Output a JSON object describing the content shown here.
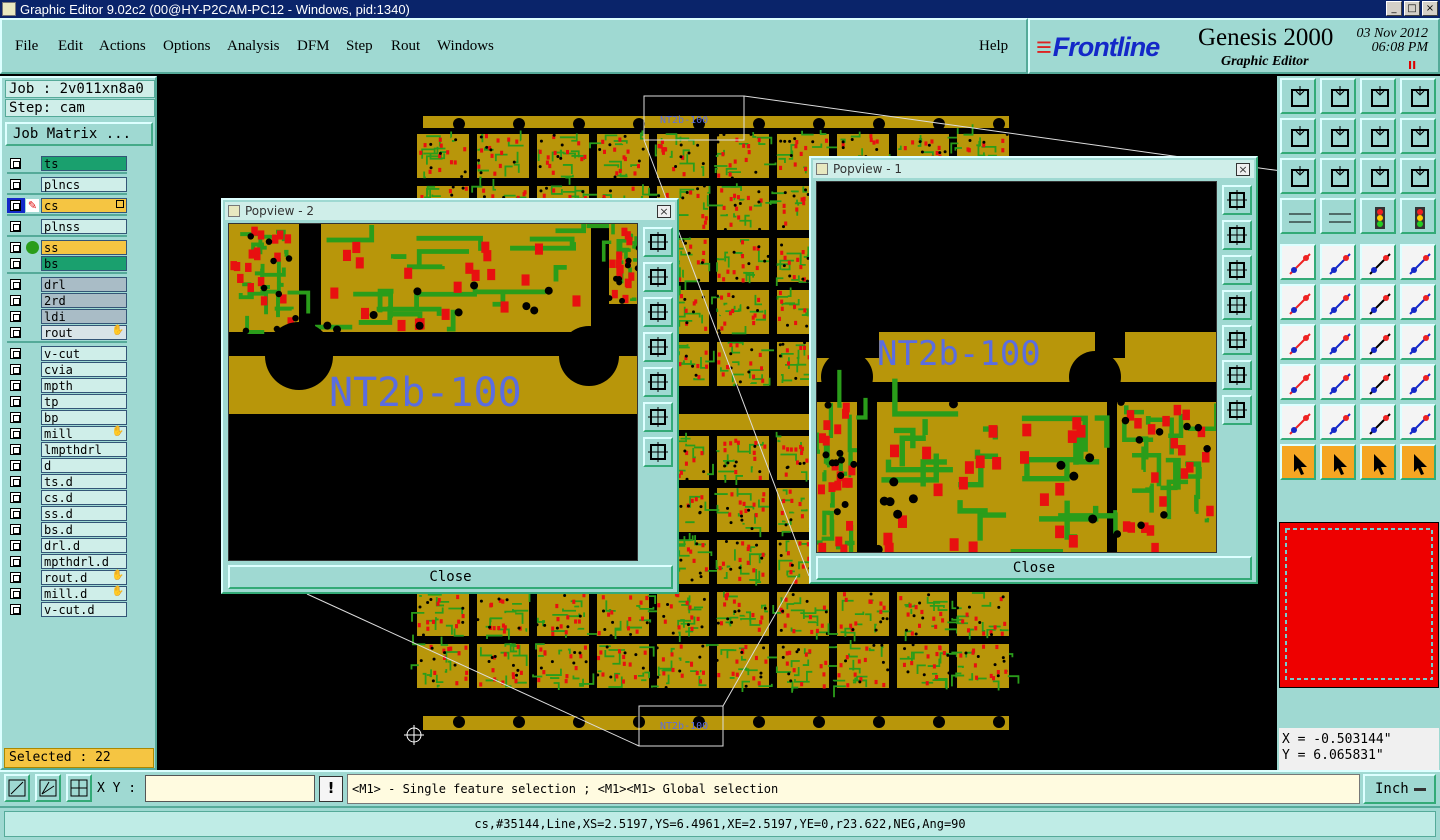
{
  "window": {
    "title": "Graphic Editor 9.02c2 (00@HY-P2CAM-PC12 - Windows, pid:1340)"
  },
  "menu": {
    "file": "File",
    "edit": "Edit",
    "actions": "Actions",
    "options": "Options",
    "analysis": "Analysis",
    "dfm": "DFM",
    "step": "Step",
    "rout": "Rout",
    "windows": "Windows",
    "help": "Help"
  },
  "brand": {
    "logo": "Frontline",
    "product": "Genesis 2000",
    "subtitle": "Graphic Editor",
    "date": "03 Nov 2012",
    "time": "06:08 PM",
    "pause_glyph": "II"
  },
  "job": {
    "job_label": "Job : 2v011xn8a0",
    "step_label": "Step: cam",
    "matrix_button": "Job Matrix ..."
  },
  "layers": [
    {
      "name": "ts",
      "color": "#1aa06e",
      "mark": ""
    },
    {
      "name": "plncs",
      "color": "#cfeee9",
      "mark": ""
    },
    {
      "name": "cs",
      "color": "#f5c542",
      "mark": "work"
    },
    {
      "name": "plnss",
      "color": "#cfeee9",
      "mark": ""
    },
    {
      "name": "ss",
      "color": "#f5c542",
      "mark": "display"
    },
    {
      "name": "bs",
      "color": "#1aa06e",
      "mark": ""
    },
    {
      "name": "drl",
      "color": "#a9bcc6",
      "mark": ""
    },
    {
      "name": "2rd",
      "color": "#a9bcc6",
      "mark": ""
    },
    {
      "name": "ldi",
      "color": "#a9bcc6",
      "mark": ""
    },
    {
      "name": "rout",
      "color": "#d8e4e8",
      "mark": "hand"
    },
    {
      "name": "v-cut",
      "color": "#cfeee9",
      "mark": ""
    },
    {
      "name": "cvia",
      "color": "#cfeee9",
      "mark": ""
    },
    {
      "name": "mpth",
      "color": "#cfeee9",
      "mark": ""
    },
    {
      "name": "tp",
      "color": "#cfeee9",
      "mark": ""
    },
    {
      "name": "bp",
      "color": "#cfeee9",
      "mark": ""
    },
    {
      "name": "mill",
      "color": "#cfeee9",
      "mark": "hand"
    },
    {
      "name": "lmpthdrl",
      "color": "#cfeee9",
      "mark": ""
    },
    {
      "name": "d",
      "color": "#cfeee9",
      "mark": ""
    },
    {
      "name": "ts.d",
      "color": "#cfeee9",
      "mark": ""
    },
    {
      "name": "cs.d",
      "color": "#cfeee9",
      "mark": ""
    },
    {
      "name": "ss.d",
      "color": "#cfeee9",
      "mark": ""
    },
    {
      "name": "bs.d",
      "color": "#cfeee9",
      "mark": ""
    },
    {
      "name": "drl.d",
      "color": "#cfeee9",
      "mark": ""
    },
    {
      "name": "mpthdrl.d",
      "color": "#cfeee9",
      "mark": ""
    },
    {
      "name": "rout.d",
      "color": "#cfeee9",
      "mark": "hand"
    },
    {
      "name": "mill.d",
      "color": "#cfeee9",
      "mark": "hand"
    },
    {
      "name": "v-cut.d",
      "color": "#cfeee9",
      "mark": ""
    }
  ],
  "selected": "Selected : 22",
  "popview2": {
    "title": "Popview - 2",
    "label_text": "NT2b-100",
    "close": "Close"
  },
  "popview1": {
    "title": "Popview - 1",
    "label_text": "NT2b-100",
    "close": "Close"
  },
  "canvas": {
    "panel_label_top": "NT2b-100",
    "panel_label_bottom": "NT2b-100"
  },
  "coords": {
    "x": "X = -0.503144\"",
    "y": "Y = 6.065831\""
  },
  "bottom": {
    "xy_label": "X Y :",
    "xy_value": "",
    "warn": "!",
    "hint": "<M1> - Single feature selection ; <M1><M1> Global selection",
    "unit": "Inch"
  },
  "status": "cs,#35144,Line,XS=2.5197,YS=6.4961,XE=2.5197,YE=0,r23.622,NEG,Ang=90",
  "colors": {
    "copper": "#b8960a",
    "trace": "#2a9d1a",
    "pad": "#e81010",
    "label": "#5b6de0",
    "panel_bg": "#9fd9d2"
  }
}
